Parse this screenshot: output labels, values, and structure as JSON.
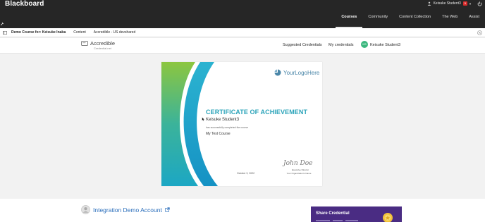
{
  "top_bar": {
    "logo": "Blackboard",
    "user_name": "Keisuke Student3",
    "notification_count": "5",
    "nav": [
      {
        "label": "Courses",
        "active": true
      },
      {
        "label": "Community",
        "active": false
      },
      {
        "label": "Content Collection",
        "active": false
      },
      {
        "label": "The Web",
        "active": false
      },
      {
        "label": "Assist",
        "active": false
      }
    ]
  },
  "breadcrumb": {
    "course": "Demo Course for: Keisuke Inaba",
    "items": [
      "Content",
      "Accredible - US devshared"
    ]
  },
  "accredible_header": {
    "logo_text": "Accredible",
    "logo_sub": "Credential.net",
    "links": [
      "Suggested Credentials",
      "My credentials"
    ],
    "avatar_initials": "KS",
    "user_name": "Keisuke Student3"
  },
  "certificate": {
    "logo_text": "YourLogoHere",
    "title": "CERTIFICATE OF ACHIEVEMENT",
    "recipient": "Keisuke Student3",
    "subtitle": "has successfully completed the course",
    "course": "My Test Course",
    "date": "October 3, 2022",
    "signature": "John Doe",
    "signer_title": "Executive Director",
    "signer_org": "Your Organization's Name"
  },
  "issuer": {
    "name": "Integration Demo Account"
  },
  "share": {
    "title": "Share Credential"
  },
  "colors": {
    "topbar": "#262626",
    "cert_title": "#2aa3b9",
    "share_panel": "#4a2c83",
    "issuer_link": "#2a6ebb"
  }
}
